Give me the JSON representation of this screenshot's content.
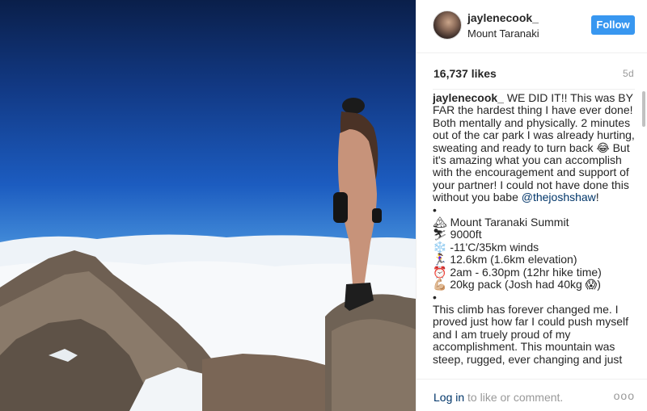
{
  "post": {
    "username": "jaylenecook_",
    "location": "Mount Taranaki",
    "follow_label": "Follow",
    "likes": "16,737 likes",
    "age": "5d",
    "caption_username": "jaylenecook_",
    "caption_para1": "WE DID IT!! This was BY FAR the hardest thing I have ever done! Both mentally and physically. 2 minutes out of the car park I was already hurting, sweating and ready to turn back 😂 But it's amazing what you can accomplish with the encouragement and support of your partner! I could not have done this without you babe",
    "mention": "@thejoshshaw",
    "mention_tail": "!",
    "bullet1": "•",
    "stats": [
      "🏔 Mount Taranaki Summit",
      "⛷ 9000ft",
      "❄️ -11'C/35km winds",
      "🏃‍♀️ 12.6km (1.6km elevation)",
      "⏰ 2am - 6.30pm (12hr hike time)",
      "💪🏼 20kg pack (Josh had 40kg 😱)"
    ],
    "bullet2": "•",
    "caption_para2": "This climb has forever changed me. I proved just how far I could push myself and I am truely proud of my accomplishment. This mountain was steep, rugged, ever changing and just"
  },
  "footer": {
    "login_label": "Log in",
    "comment_text": " to like or comment.",
    "more_label": "ooo"
  }
}
